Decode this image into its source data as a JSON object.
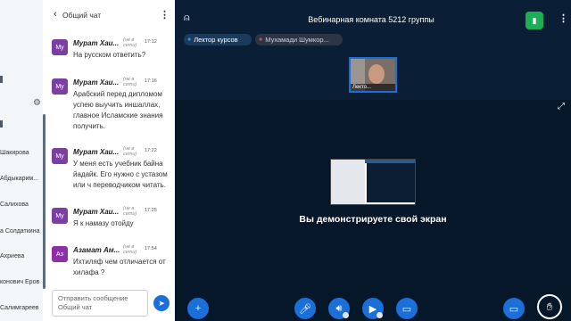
{
  "users_column": {
    "names": [
      "Шакирова",
      "Абдыкарим...",
      "Салихова",
      "а Солдаткина",
      "Ахриева",
      "конович Еров",
      "Салимгареев"
    ]
  },
  "chat": {
    "back_icon": "chevron-left-icon",
    "title": "Общий чат",
    "messages": [
      {
        "initials": "Mу",
        "name": "Мурат Хаи...",
        "status": "(не в сети)",
        "time": "17:12",
        "text": "На русском ответить?"
      },
      {
        "initials": "Mу",
        "name": "Мурат Хаи...",
        "status": "(не в сети)",
        "time": "17:16",
        "text": "Арабский перед дипломом успею выучить иншаллах, главное Исламские знания получить."
      },
      {
        "initials": "Mу",
        "name": "Мурат Хаи...",
        "status": "(не в сети)",
        "time": "17:22",
        "text": "У меня есть учебник байна йадайк. Его нужно с устазом или ч переводчиком читать."
      },
      {
        "initials": "Mу",
        "name": "Мурат Хаи...",
        "status": "(не в сети)",
        "time": "17:25",
        "text": "Я к намазу отойду"
      },
      {
        "initials": "Аз",
        "name": "Азамат Ам...",
        "status": "(не в сети)",
        "time": "17:54",
        "text": "Ихтиляф чем отличается от хилафа ?"
      }
    ],
    "input_placeholder": "Отправить сообщение Общий чат"
  },
  "meeting": {
    "room_title": "Вебинарная комната 5212 группы",
    "presenters": [
      {
        "label": "Лектор курсов"
      },
      {
        "label": "Мухамади Шумкор..."
      }
    ],
    "camera_label": "Лекто...",
    "share_message": "Вы демонстрируете свой экран"
  },
  "colors": {
    "accent": "#1b6fd8",
    "meeting_bg": "#06172a",
    "stats_green": "#1cae56",
    "avatar_mu": "#7b3fa0",
    "avatar_az": "#8e2fa8"
  }
}
